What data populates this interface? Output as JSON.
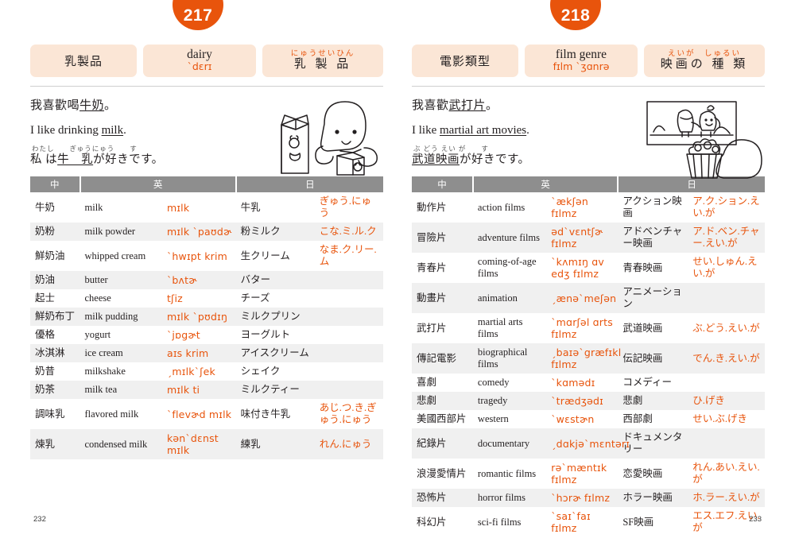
{
  "pages": [
    {
      "badge": "217",
      "folio": "232",
      "header": {
        "zh_term": "乳製品",
        "en_word": "dairy",
        "en_ipa": "ˋdɛrɪ",
        "jp_kana": "にゅうせいひん",
        "jp_term": "乳 製 品"
      },
      "example": {
        "zh_pre": "我喜歡喝",
        "zh_key": "牛奶",
        "zh_post": "。",
        "en_pre": "I like drinking ",
        "en_key": "milk",
        "en_post": ".",
        "jp_kana_line": "わたし　　ぎゅうにゅう　　す",
        "jp_pre": "私 は",
        "jp_key": "牛　乳",
        "jp_post": "が好きです。"
      },
      "illustration": "milk-carton-character-illustration",
      "table": {
        "headers": [
          "中",
          "英",
          "日"
        ],
        "rows": [
          {
            "zh": "牛奶",
            "en": "milk",
            "ipa": "mɪlk",
            "jp": "牛乳",
            "kana": "ぎゅう.にゅう"
          },
          {
            "zh": "奶粉",
            "en": "milk powder",
            "ipa": "mɪlk ˋpaʊdɚ",
            "jp": "粉ミルク",
            "kana": "こな.ミ.ル.ク"
          },
          {
            "zh": "鮮奶油",
            "en": "whipped cream",
            "ipa": "ˋhwɪpt krim",
            "jp": "生クリーム",
            "kana": "なま.ク.リー.ム"
          },
          {
            "zh": "奶油",
            "en": "butter",
            "ipa": "ˋbʌtɚ",
            "jp": "バター",
            "kana": ""
          },
          {
            "zh": "起士",
            "en": "cheese",
            "ipa": "tʃiz",
            "jp": "チーズ",
            "kana": ""
          },
          {
            "zh": "鮮奶布丁",
            "en": "milk pudding",
            "ipa": "mɪlk ˋpʊdɪŋ",
            "jp": "ミルクプリン",
            "kana": ""
          },
          {
            "zh": "優格",
            "en": "yogurt",
            "ipa": "ˋjɒgɚt",
            "jp": "ヨーグルト",
            "kana": ""
          },
          {
            "zh": "冰淇淋",
            "en": "ice cream",
            "ipa": "aɪs krim",
            "jp": "アイスクリーム",
            "kana": ""
          },
          {
            "zh": "奶昔",
            "en": "milkshake",
            "ipa": "ˏmɪlkˋʃek",
            "jp": "シェイク",
            "kana": ""
          },
          {
            "zh": "奶茶",
            "en": "milk tea",
            "ipa": "mɪlk ti",
            "jp": "ミルクティー",
            "kana": ""
          },
          {
            "zh": "調味乳",
            "en": "flavored milk",
            "ipa": "ˋflevɚd mɪlk",
            "jp": "味付き牛乳",
            "kana": "あじ.つ.き.ぎゅう.にゅう"
          },
          {
            "zh": "煉乳",
            "en": "condensed milk",
            "ipa": "kənˋdɛnst mɪlk",
            "jp": "練乳",
            "kana": "れん.にゅう"
          }
        ]
      }
    },
    {
      "badge": "218",
      "folio": "233",
      "header": {
        "zh_term": "電影類型",
        "en_word": "film genre",
        "en_ipa": "fɪlm ˋʒɑnrə",
        "jp_kana": "えいが　しゅるい",
        "jp_term": "映画の 種 類"
      },
      "example": {
        "zh_pre": "我喜歡",
        "zh_key": "武打片",
        "zh_post": "。",
        "en_pre": "I like ",
        "en_key": "martial art movies",
        "en_post": ".",
        "jp_kana_line": "ぶ どう えい が　　す",
        "jp_pre": "",
        "jp_key": "武道映画",
        "jp_post": "が好きです。"
      },
      "illustration": "movie-screen-popcorn-illustration",
      "table": {
        "headers": [
          "中",
          "英",
          "日"
        ],
        "rows": [
          {
            "zh": "動作片",
            "en": "action films",
            "ipa": "ˋækʃən fɪlmz",
            "jp": "アクション映画",
            "kana": "ア.ク.ション.えい.が"
          },
          {
            "zh": "冒險片",
            "en": "adventure films",
            "ipa": "ədˋvɛntʃɚ fɪlmz",
            "jp": "アドベンチャー映画",
            "kana": "ア.ド.ベン.チャー.えい.が"
          },
          {
            "zh": "青春片",
            "en": "coming-of-age films",
            "ipa": "ˋkʌmɪŋ ɑv edʒ fɪlmz",
            "jp": "青春映画",
            "kana": "せい.しゅん.えい.が"
          },
          {
            "zh": "動畫片",
            "en": "animation",
            "ipa": "ˏænəˋmeʃən",
            "jp": "アニメーション",
            "kana": ""
          },
          {
            "zh": "武打片",
            "en": "martial arts films",
            "ipa": "ˋmɑrʃəl ɑrts fɪlmz",
            "jp": "武道映画",
            "kana": "ぶ.どう.えい.が"
          },
          {
            "zh": "傳記電影",
            "en": "biographical films",
            "ipa": "ˏbaɪəˋgræfɪkl fɪlmz",
            "jp": "伝記映画",
            "kana": "でん.き.えい.が"
          },
          {
            "zh": "喜劇",
            "en": "comedy",
            "ipa": "ˋkɑmədɪ",
            "jp": "コメディー",
            "kana": ""
          },
          {
            "zh": "悲劇",
            "en": "tragedy",
            "ipa": "ˋtrædʒədɪ",
            "jp": "悲劇",
            "kana": "ひ.げき"
          },
          {
            "zh": "美國西部片",
            "en": "western",
            "ipa": "ˋwɛstɚn",
            "jp": "西部劇",
            "kana": "せい.ぶ.げき"
          },
          {
            "zh": "紀錄片",
            "en": "documentary",
            "ipa": "ˏdɑkjəˋmɛntərɪ",
            "jp": "ドキュメンタリー",
            "kana": ""
          },
          {
            "zh": "浪漫愛情片",
            "en": "romantic films",
            "ipa": "rəˋmæntɪk fɪlmz",
            "jp": "恋愛映画",
            "kana": "れん.あい.えい.が"
          },
          {
            "zh": "恐怖片",
            "en": "horror films",
            "ipa": "ˋhɔrɚ fɪlmz",
            "jp": "ホラー映画",
            "kana": "ホ.ラー.えい.が"
          },
          {
            "zh": "科幻片",
            "en": "sci-fi films",
            "ipa": "ˋsaɪˋfaɪ fɪlmz",
            "jp": "SF映画",
            "kana": "エス.エフ.えい.が"
          }
        ]
      }
    }
  ],
  "colors": {
    "accent": "#e8540c",
    "header_box_bg": "#fbe6d6",
    "table_header_bg": "#8e8e8e",
    "row_alt_bg": "#f0f0f0",
    "text": "#231f20"
  }
}
